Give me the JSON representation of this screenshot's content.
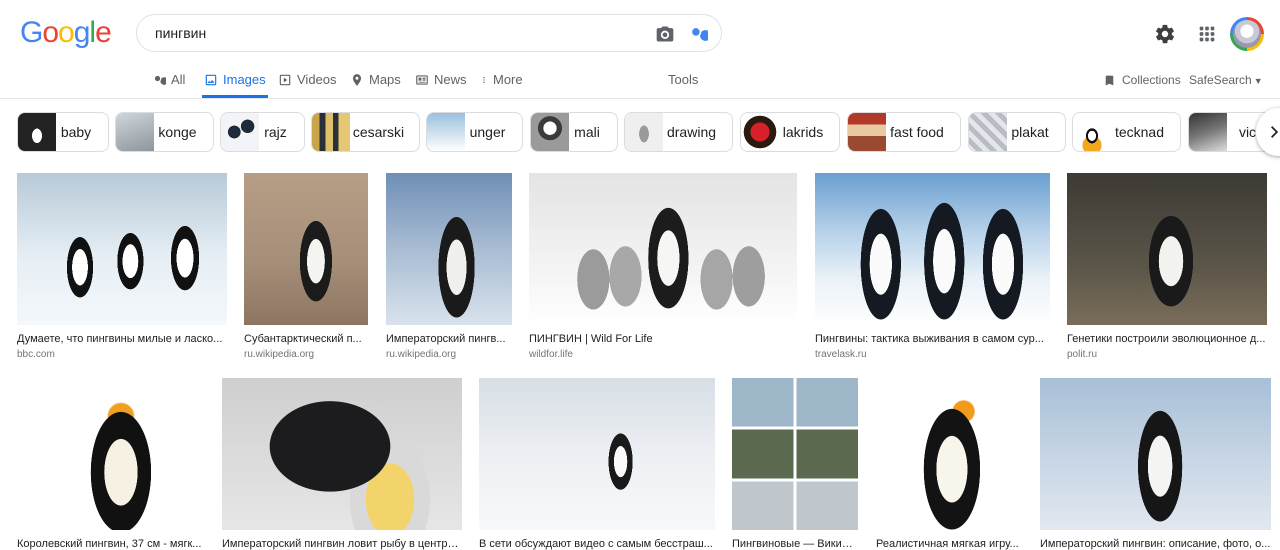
{
  "logo": {
    "letters": [
      "G",
      "o",
      "o",
      "g",
      "l",
      "e"
    ],
    "colors": [
      "#4285f4",
      "#ea4335",
      "#fbbc05",
      "#4285f4",
      "#34a853",
      "#ea4335"
    ]
  },
  "search": {
    "query": "пингвин"
  },
  "tabs": [
    {
      "label": "All",
      "icon": "search-icon"
    },
    {
      "label": "Images",
      "icon": "image-icon"
    },
    {
      "label": "Videos",
      "icon": "play-icon"
    },
    {
      "label": "Maps",
      "icon": "pin-icon"
    },
    {
      "label": "News",
      "icon": "news-icon"
    },
    {
      "label": "More",
      "icon": "more-icon"
    }
  ],
  "tools_label": "Tools",
  "collections_label": "Collections",
  "safesearch_label": "SafeSearch",
  "chips": [
    {
      "label": "baby"
    },
    {
      "label": "konge"
    },
    {
      "label": "rajz"
    },
    {
      "label": "cesarski"
    },
    {
      "label": "unger"
    },
    {
      "label": "mali"
    },
    {
      "label": "drawing"
    },
    {
      "label": "lakrids"
    },
    {
      "label": "fast food"
    },
    {
      "label": "plakat"
    },
    {
      "label": "tecknad"
    },
    {
      "label": "vicc"
    }
  ],
  "results_row1": [
    {
      "title": "Думаете, что пингвины милые и ласко...",
      "source": "bbc.com"
    },
    {
      "title": "Субантарктический п...",
      "source": "ru.wikipedia.org"
    },
    {
      "title": "Императорский пингв...",
      "source": "ru.wikipedia.org"
    },
    {
      "title": "ПИНГВИН | Wild For Life",
      "source": "wildfor.life"
    },
    {
      "title": "Пингвины: тактика выживания в самом сур...",
      "source": "travelask.ru"
    },
    {
      "title": "Генетики построили эволюционное д...",
      "source": "polit.ru"
    }
  ],
  "results_row2": [
    {
      "title": "Королевский пингвин, 37 см - мягк..."
    },
    {
      "title": "Императорский пингвин ловит рыбу в центре..."
    },
    {
      "title": "В сети обсуждают видео с самым бесстраш..."
    },
    {
      "title": "Пингвиновые — Википе..."
    },
    {
      "title": "Реалистичная мягкая игру..."
    },
    {
      "title": "Императорский пингвин: описание, фото, о..."
    }
  ]
}
